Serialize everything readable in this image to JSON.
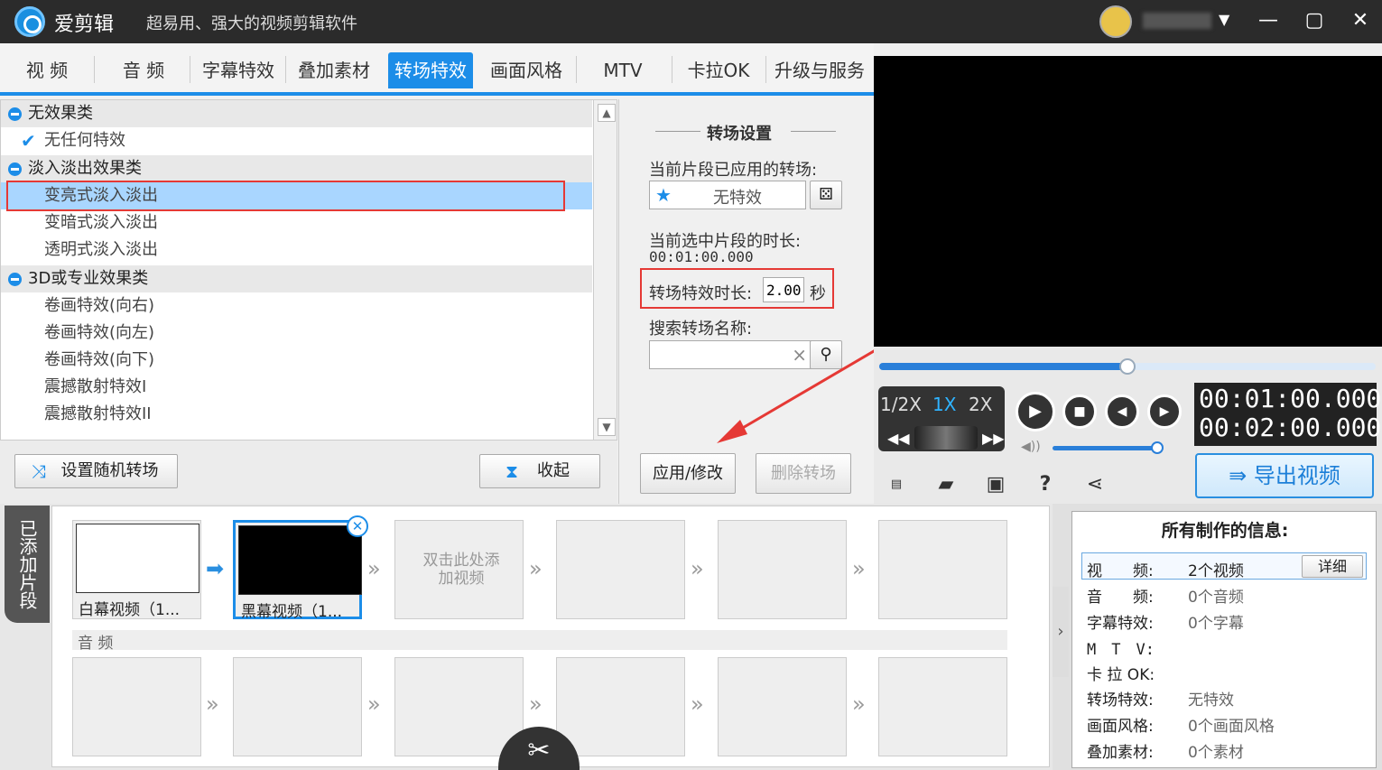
{
  "titlebar": {
    "app_name": "爱剪辑",
    "slogan": "超易用、强大的视频剪辑软件",
    "user_menu_arrow": "▼",
    "minimize": "—",
    "maximize": "▢",
    "close": "✕"
  },
  "tabs": [
    {
      "label": "视 频"
    },
    {
      "label": "音 频"
    },
    {
      "label": "字幕特效"
    },
    {
      "label": "叠加素材"
    },
    {
      "label": "转场特效",
      "active": true
    },
    {
      "label": "画面风格"
    },
    {
      "label": "MTV"
    },
    {
      "label": "卡拉OK"
    },
    {
      "label": "升级与服务"
    }
  ],
  "effects": {
    "cat1": "无效果类",
    "item_none": "无任何特效",
    "cat2": "淡入淡出效果类",
    "item_bright": "变亮式淡入淡出",
    "item_dark": "变暗式淡入淡出",
    "item_trans": "透明式淡入淡出",
    "cat3": "3D或专业效果类",
    "item_roll_r": "卷画特效(向右)",
    "item_roll_l": "卷画特效(向左)",
    "item_roll_d": "卷画特效(向下)",
    "item_shock1": "震撼散射特效I",
    "item_shock2": "震撼散射特效II"
  },
  "list_buttons": {
    "random": "设置随机转场",
    "collapse": "收起"
  },
  "settings": {
    "title": "转场设置",
    "applied_label": "当前片段已应用的转场:",
    "applied_value": "无特效",
    "duration_label": "当前选中片段的时长:",
    "duration_value": "00:01:00.000",
    "effect_duration_label": "转场特效时长:",
    "effect_duration_value": "2.00",
    "effect_duration_unit": "秒",
    "search_label": "搜索转场名称:",
    "search_clear": "×",
    "apply_button": "应用/修改",
    "delete_button": "删除转场"
  },
  "player": {
    "speed_half": "1/2X",
    "speed_1x": "1X",
    "speed_2x": "2X",
    "progress": 0.5,
    "volume": 1.0,
    "time_current": "00:01:00.000",
    "time_total": "00:02:00.000",
    "export": "导出视频"
  },
  "clips": {
    "side_label": "已添加片段",
    "clip1": "白幕视频（1...",
    "clip2": "黑幕视频（1...",
    "add_hint": "双击此处添加视频",
    "audio_label": "音 频"
  },
  "info": {
    "title": "所有制作的信息:",
    "video_label": "视　　频:",
    "video_value": "2个视频",
    "detail_button": "详细",
    "audio_label": "音　　频:",
    "audio_value": "0个音频",
    "subtitle_label": "字幕特效:",
    "subtitle_value": "0个字幕",
    "mtv_label": "M　T　V:",
    "karaoke_label": "卡 拉 OK:",
    "transition_label": "转场特效:",
    "transition_value": "无特效",
    "style_label": "画面风格:",
    "style_value": "0个画面风格",
    "overlay_label": "叠加素材:",
    "overlay_value": "0个素材"
  },
  "colors": {
    "accent": "#1c8de8",
    "highlight_box": "#e53935",
    "titlebar": "#2b2b2b"
  }
}
